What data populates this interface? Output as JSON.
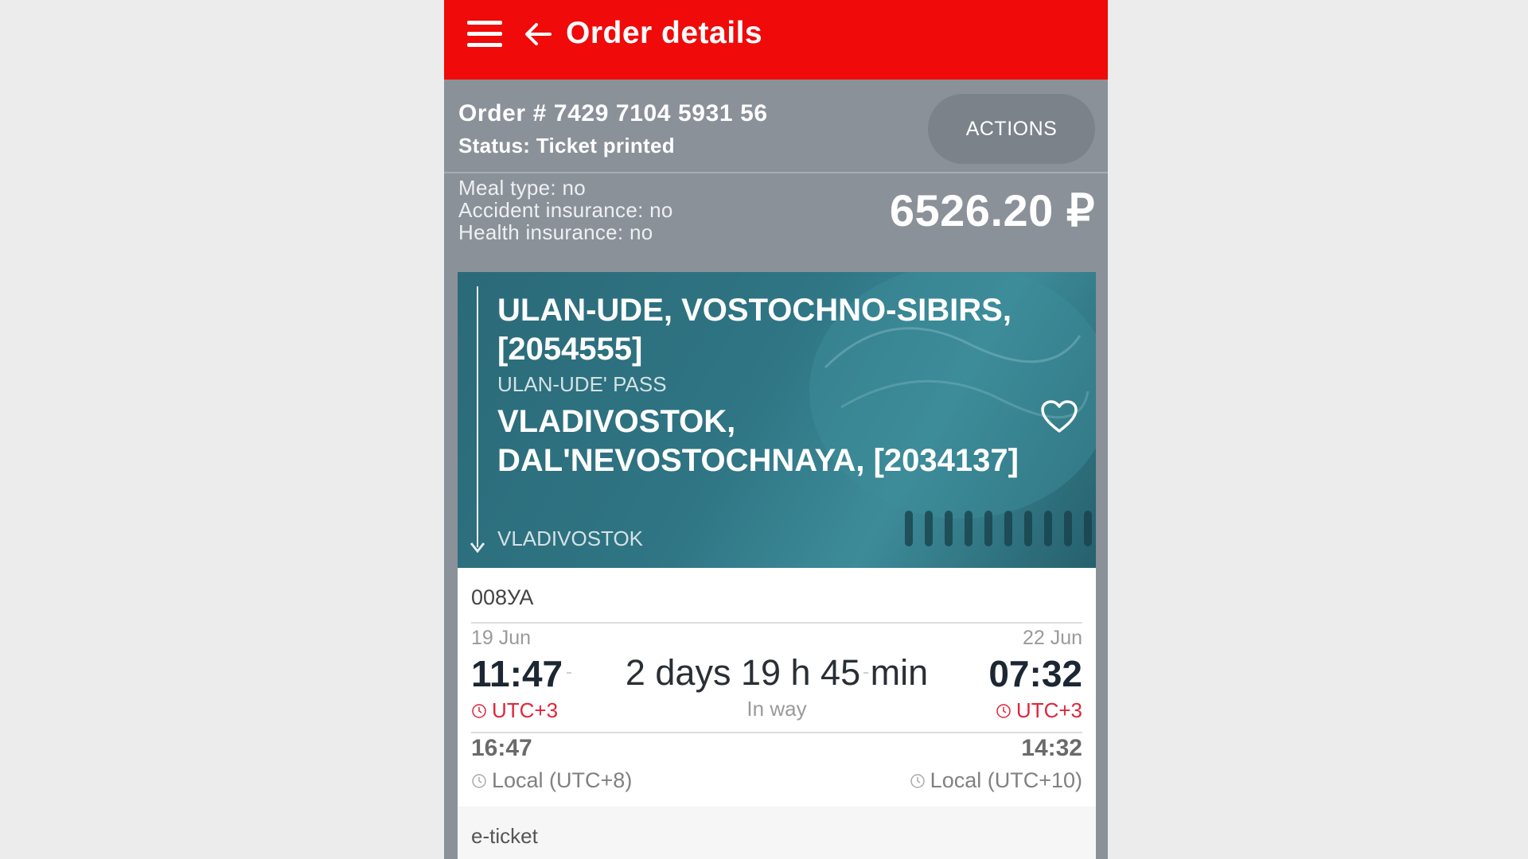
{
  "header": {
    "title": "Order details"
  },
  "order": {
    "number": "Order # 7429 7104 5931 56",
    "status": "Status: Ticket printed",
    "actions_label": "ACTIONS",
    "meal": "Meal type: no",
    "accident_insurance": "Accident insurance: no",
    "health_insurance": "Health insurance: no",
    "price": "6526.20 ₽"
  },
  "route": {
    "from_station": "ULAN-UDE, VOSTOCHNO-SIBIRS, [2054555]",
    "from_city": "ULAN-UDE' PASS",
    "to_station": "VLADIVOSTOK, DAL'NEVOSTOCHNAYA, [2034137]",
    "to_city": "VLADIVOSTOK"
  },
  "trip": {
    "train_number": "008УА",
    "departure_date": "19 Jun",
    "arrival_date": "22 Jun",
    "departure_time": "11:47",
    "arrival_time": "07:32",
    "duration": "2 days 19 h 45 min",
    "duration_label": "In way",
    "departure_tz": "UTC+3",
    "arrival_tz": "UTC+3",
    "departure_local_time": "16:47",
    "arrival_local_time": "14:32",
    "departure_local_tz": "Local (UTC+8)",
    "arrival_local_tz": "Local (UTC+10)"
  },
  "ticket_type": "e-ticket",
  "colors": {
    "header": "#f00a0a",
    "accent_tz": "#e0253a",
    "route_bg": "#2f7584"
  },
  "icons": [
    "menu-icon",
    "back-arrow-icon",
    "heart-icon",
    "clock-icon"
  ]
}
